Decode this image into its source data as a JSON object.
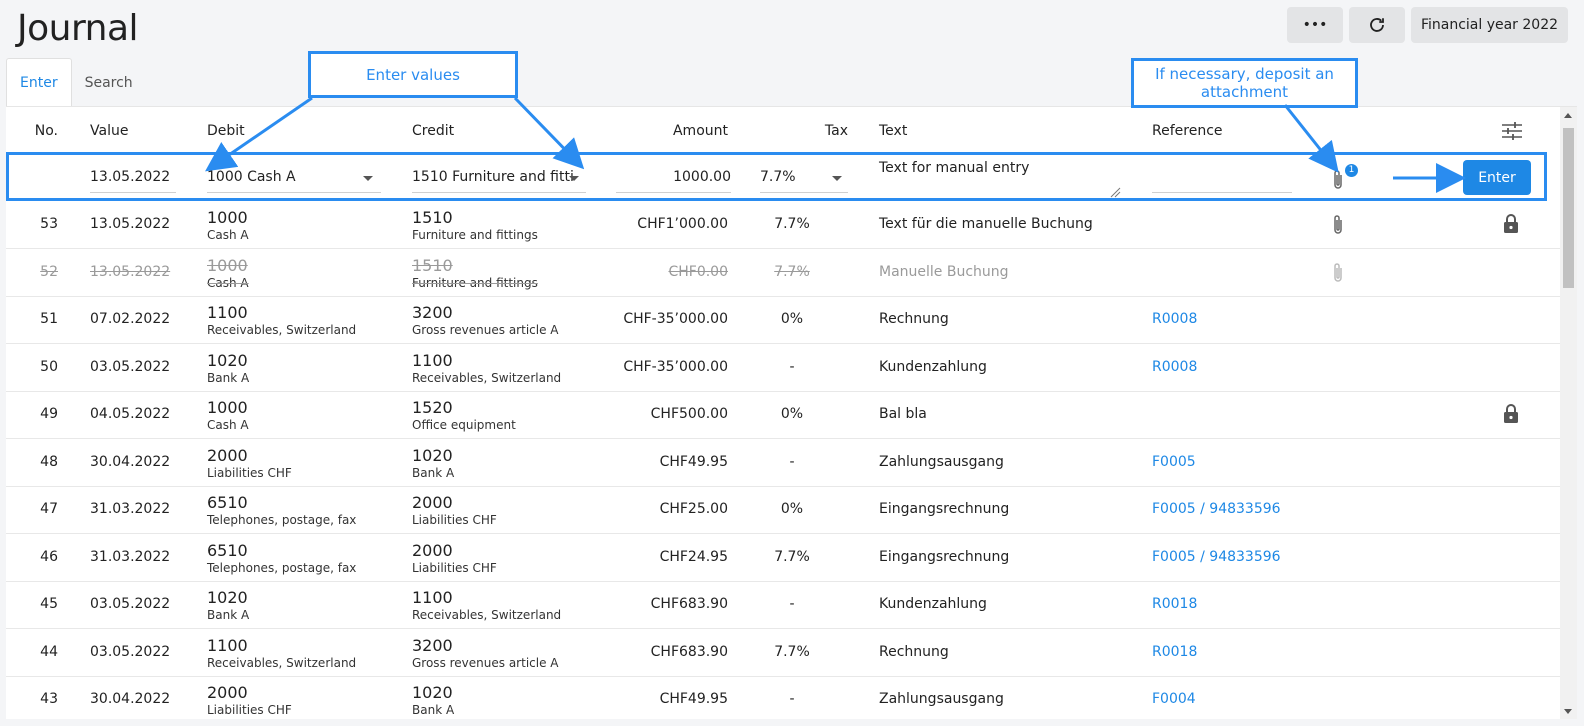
{
  "page": {
    "title": "Journal",
    "buttons": {
      "more": "•••",
      "financial_year": "Financial year 2022"
    }
  },
  "tabs": [
    "Enter",
    "Search"
  ],
  "columns": {
    "no": "No.",
    "value": "Value",
    "debit": "Debit",
    "credit": "Credit",
    "amount": "Amount",
    "tax": "Tax",
    "text": "Text",
    "reference": "Reference"
  },
  "entry": {
    "date": "13.05.2022",
    "debit": "1000 Cash A",
    "credit": "1510 Furniture and fitti",
    "amount": "1000.00",
    "tax": "7.7%",
    "text": "Text for manual entry",
    "reference": "",
    "attachment_count": "1",
    "submit_label": "Enter"
  },
  "rows": [
    {
      "no": "53",
      "date": "13.05.2022",
      "debit_num": "1000",
      "debit_name": "Cash A",
      "credit_num": "1510",
      "credit_name": "Furniture and fittings",
      "amount": "CHF1’0 00.00",
      "tax": "7.7%",
      "text": "Text für die manuelle Buchung",
      "ref": "",
      "attachment": true,
      "locked": true,
      "cancelled": false
    },
    {
      "no": "52",
      "date": "13.05.2022",
      "debit_num": "1000",
      "debit_name": "Cash A",
      "credit_num": "1510",
      "credit_name": "Furniture and fittings",
      "amount": "CHF0.00",
      "tax": "7.7%",
      "text": "Manuelle Buchung",
      "ref": "",
      "attachment": true,
      "locked": false,
      "cancelled": true
    },
    {
      "no": "51",
      "date": "07.02.2022",
      "debit_num": "1100",
      "debit_name": "Receivables, Switzerland",
      "credit_num": "3200",
      "credit_name": "Gross revenues article A",
      "amount": "CHF-35’000.00",
      "tax": "0%",
      "text": "Rechnung",
      "ref": "R0008",
      "attachment": false,
      "locked": false,
      "cancelled": false
    },
    {
      "no": "50",
      "date": "03.05.2022",
      "debit_num": "1020",
      "debit_name": "Bank A",
      "credit_num": "1100",
      "credit_name": "Receivables, Switzerland",
      "amount": "CHF-35’000.00",
      "tax": "-",
      "text": "Kundenzahlung",
      "ref": "R0008",
      "attachment": false,
      "locked": false,
      "cancelled": false
    },
    {
      "no": "49",
      "date": "04.05.2022",
      "debit_num": "1000",
      "debit_name": "Cash A",
      "credit_num": "1520",
      "credit_name": "Office equipment",
      "amount": "CHF500.00",
      "tax": "0%",
      "text": "Bal bla",
      "ref": "",
      "attachment": false,
      "locked": true,
      "cancelled": false
    },
    {
      "no": "48",
      "date": "30.04.2022",
      "debit_num": "2000",
      "debit_name": "Liabilities CHF",
      "credit_num": "1020",
      "credit_name": "Bank A",
      "amount": "CHF49.95",
      "tax": "-",
      "text": "Zahlungsausgang",
      "ref": "F0005",
      "attachment": false,
      "locked": false,
      "cancelled": false
    },
    {
      "no": "47",
      "date": "31.03.2022",
      "debit_num": "6510",
      "debit_name": "Telephones, postage, fax",
      "credit_num": "2000",
      "credit_name": "Liabilities CHF",
      "amount": "CHF25.00",
      "tax": "0%",
      "text": "Eingangsrechnung",
      "ref": "F0005 / 94833596",
      "attachment": false,
      "locked": false,
      "cancelled": false
    },
    {
      "no": "46",
      "date": "31.03.2022",
      "debit_num": "6510",
      "debit_name": "Telephones, postage, fax",
      "credit_num": "2000",
      "credit_name": "Liabilities CHF",
      "amount": "CHF24.95",
      "tax": "7.7%",
      "text": "Eingangsrechnung",
      "ref": "F0005 / 94833596",
      "attachment": false,
      "locked": false,
      "cancelled": false
    },
    {
      "no": "45",
      "date": "03.05.2022",
      "debit_num": "1020",
      "debit_name": "Bank A",
      "credit_num": "1100",
      "credit_name": "Receivables, Switzerland",
      "amount": "CHF683.90",
      "tax": "-",
      "text": "Kundenzahlung",
      "ref": "R0018",
      "attachment": false,
      "locked": false,
      "cancelled": false
    },
    {
      "no": "44",
      "date": "03.05.2022",
      "debit_num": "1100",
      "debit_name": "Receivables, Switzerland",
      "credit_num": "3200",
      "credit_name": "Gross revenues article A",
      "amount": "CHF683.90",
      "tax": "7.7%",
      "text": "Rechnung",
      "ref": "R0018",
      "attachment": false,
      "locked": false,
      "cancelled": false
    },
    {
      "no": "43",
      "date": "30.04.2022",
      "debit_num": "2000",
      "debit_name": "Liabilities CHF",
      "credit_num": "1020",
      "credit_name": "Bank A",
      "amount": "CHF49.95",
      "tax": "-",
      "text": "Zahlungsausgang",
      "ref": "F0004",
      "attachment": false,
      "locked": false,
      "cancelled": false
    }
  ],
  "callouts": {
    "enter_values": "Enter values",
    "attachment": "If necessary, deposit an attachment"
  },
  "colors": {
    "accent": "#1e88e5",
    "callout": "#2a8cf0"
  }
}
